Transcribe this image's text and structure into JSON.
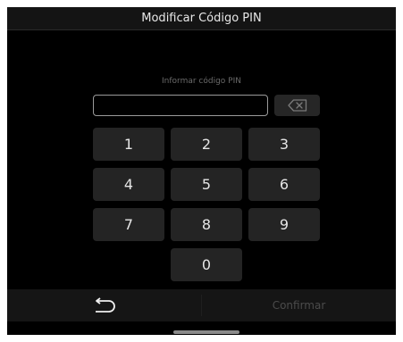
{
  "title": "Modificar Código PIN",
  "prompt": "Informar código PIN",
  "pin": {
    "value": "",
    "placeholder": ""
  },
  "keypad": {
    "keys": [
      "1",
      "2",
      "3",
      "4",
      "5",
      "6",
      "7",
      "8",
      "9",
      "0"
    ]
  },
  "footer": {
    "back_icon": "return-arrow-icon",
    "confirm_label": "Confirmar"
  },
  "icons": {
    "backspace": "backspace-icon",
    "home": "home-indicator"
  },
  "colors": {
    "background": "#000000",
    "key_bg": "#242424",
    "disabled_text": "#4b4b4b"
  }
}
